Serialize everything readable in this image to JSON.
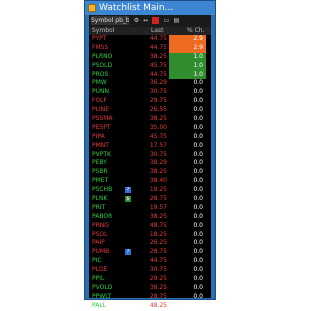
{
  "window": {
    "title": "Watchlist Main..."
  },
  "toolbar": {
    "list_label": "Symbol  pb_b...",
    "icons": [
      "gear-icon",
      "arrows-icon",
      "stop-icon",
      "print-icon",
      "chart-icon"
    ]
  },
  "columns": {
    "symbol": "Symbol",
    "last": "Last",
    "pct": "% Ch."
  },
  "colors": {
    "up": "#2ecc40",
    "down": "#e23a3a",
    "orange": "#ee6a1e",
    "green": "#2f8c2f"
  },
  "rows": [
    {
      "symbol": "PYPT",
      "last": "44.75",
      "pct": "2.9",
      "bg": "orange",
      "color": "down"
    },
    {
      "symbol": "FMSS",
      "last": "44.75",
      "pct": "2.9",
      "bg": "orange",
      "color": "down"
    },
    {
      "symbol": "PLRNO",
      "last": "38.25",
      "pct": "1.0",
      "bg": "green",
      "color": "up"
    },
    {
      "symbol": "PSOLD",
      "last": "45.75",
      "pct": "1.0",
      "bg": "green",
      "color": "up"
    },
    {
      "symbol": "PROS",
      "last": "44.75",
      "pct": "1.0",
      "bg": "green",
      "color": "up"
    },
    {
      "symbol": "PMW",
      "last": "36.29",
      "pct": "0.0",
      "bg": "",
      "color": "up"
    },
    {
      "symbol": "PUNN",
      "last": "30.75",
      "pct": "0.0",
      "bg": "",
      "color": "up"
    },
    {
      "symbol": "FOLF",
      "last": "29.75",
      "pct": "0.0",
      "bg": "",
      "color": "down"
    },
    {
      "symbol": "PLINE",
      "last": "26.55",
      "pct": "0.0",
      "bg": "",
      "color": "down"
    },
    {
      "symbol": "PSSMA",
      "last": "38.25",
      "pct": "0.0",
      "bg": "",
      "color": "down"
    },
    {
      "symbol": "PESPT",
      "last": "35.00",
      "pct": "0.0",
      "bg": "",
      "color": "down"
    },
    {
      "symbol": "PIPA",
      "last": "45.75",
      "pct": "0.0",
      "bg": "",
      "color": "down"
    },
    {
      "symbol": "PMNT",
      "last": "17.57",
      "pct": "0.0",
      "bg": "",
      "color": "down"
    },
    {
      "symbol": "PVPTK",
      "last": "30.75",
      "pct": "0.0",
      "bg": "",
      "color": "up"
    },
    {
      "symbol": "PEBY",
      "last": "38.29",
      "pct": "0.0",
      "bg": "",
      "color": "up"
    },
    {
      "symbol": "PSBR",
      "last": "38.25",
      "pct": "0.0",
      "bg": "",
      "color": "up"
    },
    {
      "symbol": "PMET",
      "last": "38.40",
      "pct": "0.0",
      "bg": "",
      "color": "up"
    },
    {
      "symbol": "PSCHB",
      "last": "19.25",
      "pct": "0.0",
      "bg": "",
      "color": "up",
      "mark": "?"
    },
    {
      "symbol": "PLNK",
      "last": "28.75",
      "pct": "0.0",
      "bg": "",
      "color": "up",
      "mark": "$"
    },
    {
      "symbol": "PRIT",
      "last": "19.57",
      "pct": "0.0",
      "bg": "",
      "color": "up"
    },
    {
      "symbol": "PABOR",
      "last": "38.25",
      "pct": "0.0",
      "bg": "",
      "color": "up"
    },
    {
      "symbol": "PRNG",
      "last": "48.75",
      "pct": "0.0",
      "bg": "",
      "color": "down"
    },
    {
      "symbol": "PSOL",
      "last": "18.25",
      "pct": "0.0",
      "bg": "",
      "color": "down"
    },
    {
      "symbol": "PAIP",
      "last": "26.25",
      "pct": "0.0",
      "bg": "",
      "color": "down"
    },
    {
      "symbol": "PUMB",
      "last": "28.75",
      "pct": "0.0",
      "bg": "",
      "color": "down",
      "mark": "?"
    },
    {
      "symbol": "PIC",
      "last": "44.75",
      "pct": "0.0",
      "bg": "",
      "color": "up"
    },
    {
      "symbol": "PLDE",
      "last": "30.75",
      "pct": "0.0",
      "bg": "",
      "color": "down"
    },
    {
      "symbol": "PPIL",
      "last": "29.25",
      "pct": "0.0",
      "bg": "",
      "color": "up"
    },
    {
      "symbol": "PVOLD",
      "last": "38.25",
      "pct": "0.0",
      "bg": "",
      "color": "up"
    },
    {
      "symbol": "PPWLT",
      "last": "28.75",
      "pct": "0.0",
      "bg": "",
      "color": "up"
    },
    {
      "symbol": "PALL",
      "last": "48.25",
      "pct": "0.0",
      "bg": "",
      "color": "up"
    }
  ]
}
